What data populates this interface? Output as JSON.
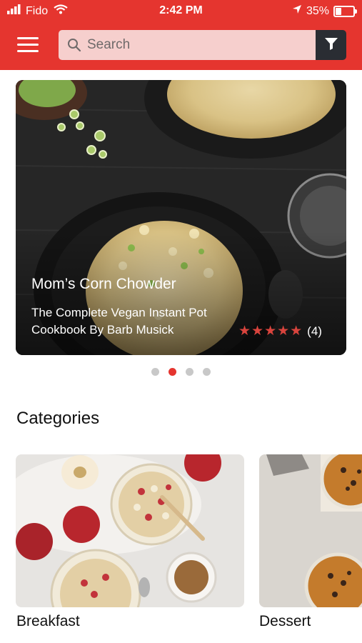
{
  "status_bar": {
    "carrier": "Fido",
    "time": "2:42 PM",
    "battery": "35%",
    "battery_level": 0.35
  },
  "header": {
    "menu_icon": "hamburger-menu-icon",
    "search_placeholder": "Search",
    "search_icon": "search-icon",
    "filter_icon": "filter-funnel-icon",
    "brand_color": "#e5352f"
  },
  "featured": {
    "title": "Mom’s Corn Chowder",
    "subtitle": "The Complete Vegan Instant Pot Cookbook By Barb Musick",
    "stars": "★★★★★",
    "rating": 5,
    "review_count": "(4)",
    "star_color": "#d9443d"
  },
  "carousel": {
    "pages": 4,
    "active_index": 1
  },
  "categories": {
    "heading": "Categories",
    "items": [
      {
        "label": "Breakfast"
      },
      {
        "label": "Dessert"
      }
    ]
  }
}
